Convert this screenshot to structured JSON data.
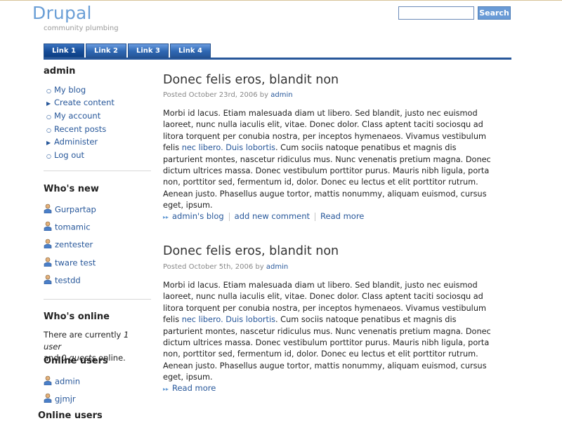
{
  "site": {
    "name": "Drupal",
    "slogan": "community plumbing"
  },
  "search": {
    "button": "Search",
    "value": ""
  },
  "tabs": [
    "Link 1",
    "Link 2",
    "Link 3",
    "Link 4"
  ],
  "user_block": {
    "title": "admin",
    "items": [
      "My blog",
      "Create content",
      "My account",
      "Recent posts",
      "Administer",
      "Log out"
    ]
  },
  "whos_new": {
    "title": "Who's new",
    "users": [
      "Gurpartap",
      "tomamic",
      "zentester",
      "tware test",
      "testdd"
    ]
  },
  "whos_online": {
    "title": "Who's online",
    "text_1": "There are currently",
    "count_users": "1 user",
    "text_2": "and",
    "count_guests": "0 guests",
    "text_3": "online.",
    "online_users_title": "Online users",
    "users": [
      "admin",
      "gjmjr"
    ],
    "online_users_title_2": "Online users"
  },
  "posts": [
    {
      "title": "Donec felis eros, blandit non",
      "posted": "Posted October 23rd, 2006 by",
      "author": "admin",
      "body_1": "Morbi id lacus. Etiam malesuada diam ut libero. Sed blandit, justo nec euismod laoreet, nunc nulla iaculis elit, vitae. Donec dolor. Class aptent taciti sociosqu ad litora torquent per conubia nostra, per inceptos hymenaeos. Vivamus vestibulum felis",
      "body_link": "nec libero. Duis lobortis",
      "body_2": ". Cum sociis natoque penatibus et magnis dis parturient montes, nascetur ridiculus mus. Nunc venenatis pretium magna. Donec dictum ultrices massa. Donec vestibulum porttitor purus. Mauris nibh ligula, porta non, porttitor sed, fermentum id, dolor. Donec eu lectus et elit porttitor rutrum. Aenean justo. Phasellus augue tortor, mattis nonummy, aliquam euismod, cursus eget, ipsum.",
      "links": [
        "admin's blog",
        "add new comment",
        "Read more"
      ]
    },
    {
      "title": "Donec felis eros, blandit non",
      "posted": "Posted October 5th, 2006 by",
      "author": "admin",
      "body_1": "Morbi id lacus. Etiam malesuada diam ut libero. Sed blandit, justo nec euismod laoreet, nunc nulla iaculis elit, vitae. Donec dolor. Class aptent taciti sociosqu ad litora torquent per conubia nostra, per inceptos hymenaeos. Vivamus vestibulum felis",
      "body_link": "nec libero. Duis lobortis",
      "body_2": ". Cum sociis natoque penatibus et magnis dis parturient montes, nascetur ridiculus mus. Nunc venenatis pretium magna. Donec dictum ultrices massa. Donec vestibulum porttitor purus. Mauris nibh ligula, porta non, porttitor sed, fermentum id, dolor. Donec eu lectus et elit porttitor rutrum. Aenean justo. Phasellus augue tortor, mattis nonummy, aliquam euismod, cursus eget, ipsum.",
      "links": [
        "Read more"
      ]
    }
  ],
  "colors": {
    "link": "#27579a",
    "accent": "#6b9fd6",
    "nav_bar": "#27579a"
  },
  "icons": {
    "user": "user-icon",
    "menu_bullet": "circle-bullet-icon",
    "menu_arrow": "triangle-arrow-icon",
    "link_arrow": "double-chevron-icon"
  }
}
